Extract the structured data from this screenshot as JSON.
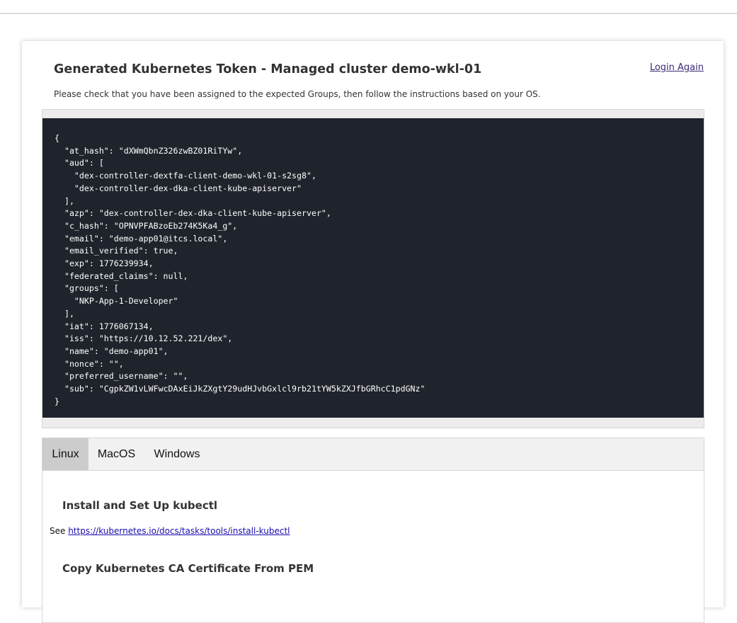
{
  "header": {
    "title": "Generated Kubernetes Token - Managed cluster demo-wkl-01",
    "login_again": "Login Again",
    "subtitle": "Please check that you have been assigned to the expected Groups, then follow the instructions based on your OS."
  },
  "token_json": "{\n  \"at_hash\": \"dXWmQbnZ326zwBZ01RiTYw\",\n  \"aud\": [\n    \"dex-controller-dextfa-client-demo-wkl-01-s2sg8\",\n    \"dex-controller-dex-dka-client-kube-apiserver\"\n  ],\n  \"azp\": \"dex-controller-dex-dka-client-kube-apiserver\",\n  \"c_hash\": \"OPNVPFABzoEb274K5Ka4_g\",\n  \"email\": \"demo-app01@itcs.local\",\n  \"email_verified\": true,\n  \"exp\": 1776239934,\n  \"federated_claims\": null,\n  \"groups\": [\n    \"NKP-App-1-Developer\"\n  ],\n  \"iat\": 1776067134,\n  \"iss\": \"https://10.12.52.221/dex\",\n  \"name\": \"demo-app01\",\n  \"nonce\": \"\",\n  \"preferred_username\": \"\",\n  \"sub\": \"CgpkZW1vLWFwcDAxEiJkZXgtY29udHJvbGxlcl9rb21tYW5kZXJfbGRhcC1pdGNz\"\n}",
  "tabs": [
    {
      "label": "Linux",
      "active": true
    },
    {
      "label": "MacOS",
      "active": false
    },
    {
      "label": "Windows",
      "active": false
    }
  ],
  "linux": {
    "section1_heading": "Install and Set Up kubectl",
    "see_prefix": "See ",
    "install_link": "https://kubernetes.io/docs/tasks/tools/install-kubectl",
    "section2_heading": "Copy Kubernetes CA Certificate From PEM"
  }
}
